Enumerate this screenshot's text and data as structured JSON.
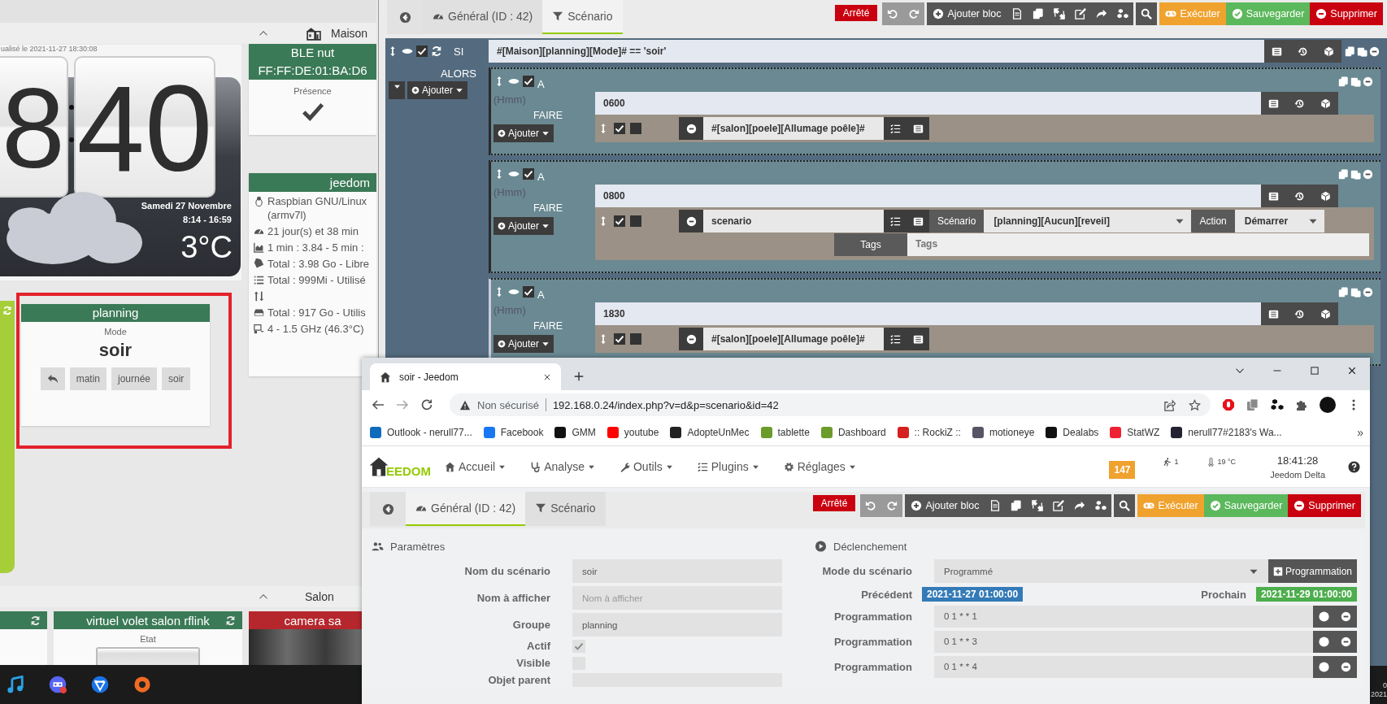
{
  "dashboard": {
    "sections": [
      {
        "title": "Maison"
      },
      {
        "title": "Salon"
      }
    ],
    "clock": {
      "updated": "ualisé le 2021-11-27 18:30:08",
      "hour": "8",
      "minutes": "40",
      "date": "Samedi 27 Novembre",
      "sun": "8:14 - 16:59",
      "temperature": "3°C"
    },
    "presence_card": {
      "title_lines": [
        "BLE nut",
        "FF:FF:DE:01:BA:D6"
      ],
      "label": "Présence",
      "present": true
    },
    "system_card": {
      "title": "jeedom",
      "lines": [
        {
          "kind": "os",
          "text": "Raspbian GNU/Linux (armv7l)"
        },
        {
          "kind": "uptime",
          "text": "21 jour(s) et 38 min"
        },
        {
          "kind": "load",
          "text": "1 min : 3.84 - 5 min :"
        },
        {
          "kind": "disk",
          "text": "Total : 3.98 Go - Libre"
        },
        {
          "kind": "memory",
          "text": "Total : 999Mi - Utilisé"
        },
        {
          "kind": "network"
        },
        {
          "kind": "storage",
          "text": "Total : 917 Go - Utilis"
        },
        {
          "kind": "cpu",
          "text": "4 - 1.5 GHz (46.3°C)"
        }
      ]
    },
    "planning_card": {
      "title": "planning",
      "label": "Mode",
      "value": "soir",
      "highlighted": true,
      "buttons": [
        {
          "kind": "back"
        },
        {
          "kind": "text",
          "label": "matin"
        },
        {
          "kind": "text",
          "label": "journée"
        },
        {
          "kind": "text",
          "label": "soir"
        }
      ]
    },
    "tiles": [
      {
        "color": "#3b7a57",
        "kind": "refresh"
      },
      {
        "title": "virtuel volet salon rflink",
        "color": "#3b7a57",
        "kind": "shutter",
        "label": "Etat"
      },
      {
        "title": "camera sa",
        "color": "#b5272d",
        "kind": "camera"
      }
    ]
  },
  "taskbar": {
    "tray_lines": [
      "0",
      "2021"
    ]
  },
  "scenario_editor": {
    "tabs": [
      {
        "label": "Général (ID : 42)",
        "selected": false
      },
      {
        "label": "Scénario",
        "selected": true
      }
    ],
    "status": "Arrêté",
    "toolbar": {
      "add_block": "Ajouter bloc",
      "execute": "Exécuter",
      "save": "Sauvegarder",
      "delete": "Supprimer"
    },
    "condition": {
      "keyword": "SI",
      "enabled": true,
      "expression": "#[Maison][planning][Mode]# == 'soir'",
      "then_label": "ALORS",
      "add_label": "Ajouter"
    },
    "blocks": [
      {
        "keyword": "A",
        "enabled": true,
        "hint": "(Hmm)",
        "time": "0600",
        "do_label": "FAIRE",
        "add_label": "Ajouter",
        "actions": [
          {
            "kind": "command",
            "enabled": true,
            "parallel": false,
            "value": "#[salon][poele][Allumage poêle]#"
          }
        ]
      },
      {
        "keyword": "A",
        "enabled": true,
        "hint": "(Hmm)",
        "time": "0800",
        "do_label": "FAIRE",
        "add_label": "Ajouter",
        "actions": [
          {
            "kind": "scenario",
            "enabled": true,
            "parallel": false,
            "value": "scenario",
            "scenario_label": "Scénario",
            "scenario_value": "[planning][Aucun][reveil]",
            "action_label": "Action",
            "action_value": "Démarrer",
            "tags_label": "Tags",
            "tags_placeholder": "Tags"
          }
        ]
      },
      {
        "keyword": "A",
        "enabled": true,
        "hint": "(Hmm)",
        "time": "1830",
        "do_label": "FAIRE",
        "add_label": "Ajouter",
        "actions": [
          {
            "kind": "command",
            "enabled": true,
            "parallel": false,
            "value": "#[salon][poele][Allumage poêle]#"
          }
        ]
      }
    ]
  },
  "browser": {
    "tab_title": "soir - Jeedom",
    "security": "Non sécurisé",
    "url": "192.168.0.24/index.php?v=d&p=scenario&id=42",
    "bookmarks": [
      {
        "label": "Outlook - nerull77..."
      },
      {
        "label": "Facebook"
      },
      {
        "label": "GMM"
      },
      {
        "label": "youtube"
      },
      {
        "label": "AdopteUnMec"
      },
      {
        "label": "tablette"
      },
      {
        "label": "Dashboard"
      },
      {
        "label": ":: RockiZ ::"
      },
      {
        "label": "motioneye"
      },
      {
        "label": "Dealabs"
      },
      {
        "label": "StatWZ"
      },
      {
        "label": "nerull77#2183's Wa..."
      }
    ],
    "bookmarks_more": "»"
  },
  "jeedom_nav": {
    "logo_text": "EEDOM",
    "menus": [
      "Accueil",
      "Analyse",
      "Outils",
      "Plugins",
      "Réglages"
    ],
    "badge": "147",
    "presence": "1",
    "temperature": "19 °C",
    "time": "18:41:28",
    "name": "Jeedom Delta"
  },
  "scenario_page": {
    "tabs": [
      {
        "label": "Général (ID : 42)",
        "selected": true
      },
      {
        "label": "Scénario",
        "selected": false
      }
    ],
    "status": "Arrêté",
    "toolbar": {
      "add_block": "Ajouter bloc",
      "execute": "Exécuter",
      "save": "Sauvegarder",
      "delete": "Supprimer"
    },
    "parameters": {
      "title": "Paramètres",
      "fields": [
        {
          "label": "Nom du scénario",
          "value": "soir"
        },
        {
          "label": "Nom à afficher",
          "placeholder": "Nom à afficher"
        },
        {
          "label": "Groupe",
          "value": "planning"
        }
      ],
      "checks": [
        {
          "label": "Actif",
          "checked": true
        },
        {
          "label": "Visible",
          "checked": false
        }
      ],
      "parent_label": "Objet parent"
    },
    "trigger": {
      "title": "Déclenchement",
      "mode_label": "Mode du scénario",
      "mode_value": "Programmé",
      "add_button": "Programmation",
      "previous_label": "Précédent",
      "previous_value": "2021-11-27 01:00:00",
      "next_label": "Prochain",
      "next_value": "2021-11-29 01:00:00",
      "schedules": [
        {
          "label": "Programmation",
          "value": "0 1 * * 1"
        },
        {
          "label": "Programmation",
          "value": "0 1 * * 3"
        },
        {
          "label": "Programmation",
          "value": "0 1 * * 4"
        }
      ]
    }
  }
}
